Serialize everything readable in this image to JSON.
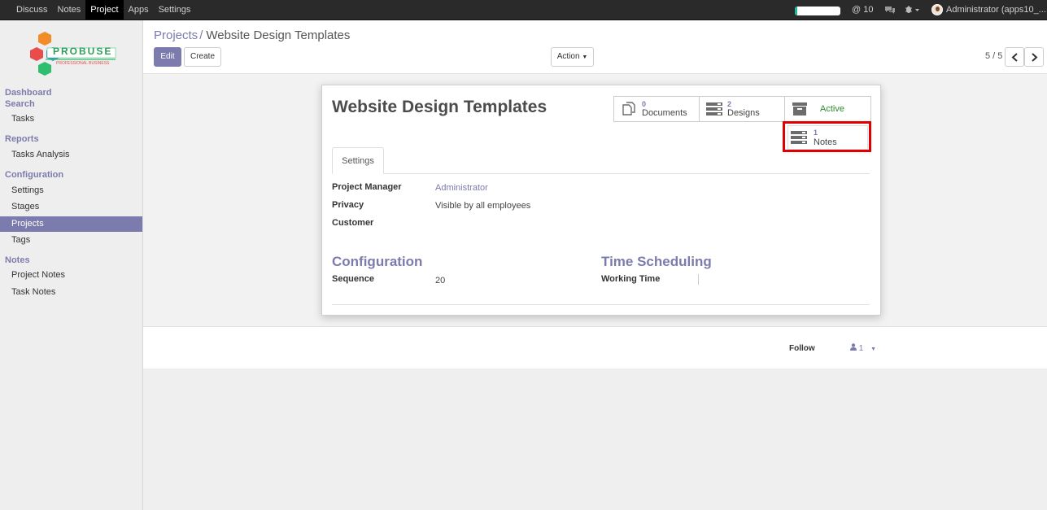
{
  "topbar": {
    "menu": [
      "Discuss",
      "Notes",
      "Project",
      "Apps",
      "Settings"
    ],
    "active_menu": "Project",
    "progress_fraction": 0.05,
    "mentions_count": "@ 10",
    "chat_icon": "chat-bubbles-icon",
    "debug_icon": "bug-icon",
    "user_name": "Administrator (apps10_..."
  },
  "sidebar": {
    "logo_text": "PROBUSE",
    "logo_subtext": "PROFESSIONAL BUSINESS",
    "sections": [
      {
        "title": "Dashboard Search",
        "items": [
          "Tasks"
        ]
      },
      {
        "title": "Reports",
        "items": [
          "Tasks Analysis"
        ]
      },
      {
        "title": "Configuration",
        "items": [
          "Settings",
          "Stages",
          "Projects",
          "Tags"
        ]
      },
      {
        "title": "Notes",
        "items": [
          "Project Notes",
          "Task Notes"
        ]
      }
    ],
    "active_item": "Projects"
  },
  "control": {
    "breadcrumb_root": "Projects",
    "breadcrumb_sep": "/",
    "breadcrumb_current": "Website Design Templates",
    "edit_label": "Edit",
    "create_label": "Create",
    "action_label": "Action",
    "pager": "5 / 5"
  },
  "form": {
    "title": "Website Design Templates",
    "smart_buttons": {
      "documents": {
        "count": "0",
        "label": "Documents"
      },
      "designs": {
        "count": "2",
        "label": "Designs"
      },
      "active": {
        "label": "Active"
      },
      "notes": {
        "count": "1",
        "label": "Notes"
      }
    },
    "tab": "Settings",
    "fields": {
      "project_manager_label": "Project Manager",
      "project_manager_value": "Administrator",
      "privacy_label": "Privacy",
      "privacy_value": "Visible by all employees",
      "customer_label": "Customer",
      "customer_value": ""
    },
    "configuration": {
      "heading": "Configuration",
      "sequence_label": "Sequence",
      "sequence_value": "20"
    },
    "time_scheduling": {
      "heading": "Time Scheduling",
      "working_time_label": "Working Time",
      "working_time_value": ""
    }
  },
  "chatter": {
    "follow_label": "Follow",
    "followers_count": "1"
  },
  "colors": {
    "brand": "#7c7bad",
    "topbar": "#2a2a2a",
    "active_green": "#2d8b2d",
    "highlight_red": "#e00000"
  }
}
